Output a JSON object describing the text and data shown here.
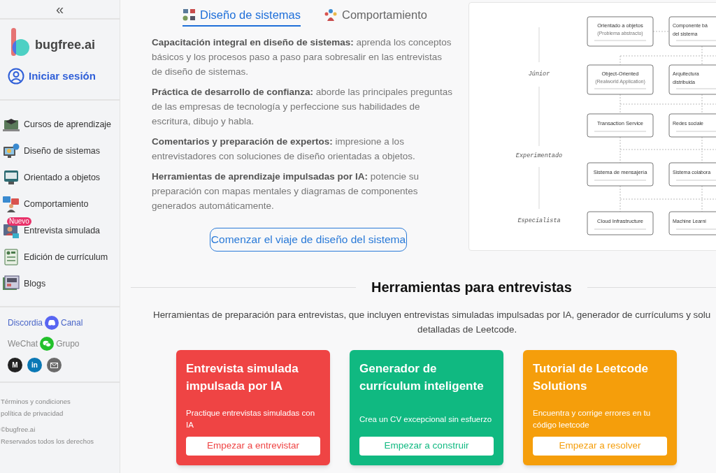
{
  "sidebar": {
    "collapse": "«",
    "brand": "bugfree.ai",
    "login": "Iniciar sesión",
    "items": [
      {
        "label": "Cursos de aprendizaje",
        "kind": "course"
      },
      {
        "label": "Diseño de sistemas",
        "kind": "system"
      },
      {
        "label": "Orientado a objetos",
        "kind": "oop"
      },
      {
        "label": "Comportamiento",
        "kind": "behavior"
      },
      {
        "label": "Entrevista simulada",
        "kind": "mock",
        "badge": "Nuevo"
      },
      {
        "label": "Edición de currículum",
        "kind": "resume"
      },
      {
        "label": "Blogs",
        "kind": "blog"
      }
    ],
    "communities": [
      {
        "label": "Discordia",
        "kind": "discord",
        "group": "Canal"
      },
      {
        "label": "WeChat",
        "kind": "wechat",
        "group": "Grupo"
      }
    ],
    "socials": [
      {
        "kind": "medium",
        "label": "M"
      },
      {
        "kind": "linkedin",
        "label": "in"
      },
      {
        "kind": "mail"
      }
    ],
    "footer": [
      "Términos y condiciones",
      "política de privacidad",
      "©bugfree.ai",
      "Reservados todos los derechos"
    ]
  },
  "tabs": [
    {
      "label": "Diseño de sistemas",
      "kind": "system",
      "selected": true
    },
    {
      "label": "Comportamiento",
      "kind": "behavior",
      "selected": false
    }
  ],
  "features": [
    "**Capacitación integral en diseño de sistemas:** aprenda los conceptos básicos y los procesos paso a paso para sobresalir en las entrevistas de diseño de sistemas.",
    "**Práctica de desarrollo de confianza:** aborde las principales preguntas de las empresas de tecnología y perfeccione sus habilidades de escritura, dibujo y habla.",
    "**Comentarios y preparación de expertos:** impresione a los entrevistadores con soluciones de diseño orientadas a objetos.",
    "**Herramientas de aprendizaje impulsadas por IA:** potencie su preparación con mapas mentales y diagramas de componentes generados automáticamente."
  ],
  "cta": "Comenzar el viaje de diseño del sistema",
  "roadmap": {
    "levels": [
      "Júnior",
      "Experimentado",
      "Especialista"
    ],
    "rows": [
      [
        {
          "lines": [
            "Orientado a objetos"
          ],
          "note": "(Problema abstracto)"
        },
        {
          "lines": [
            "Componente bá",
            "del sistema"
          ]
        }
      ],
      [
        {
          "lines": [
            "Object-Oriented"
          ],
          "note": "(Realworld Application)"
        },
        {
          "lines": [
            "Arquitectura",
            "distribuida"
          ]
        }
      ],
      [
        {
          "lines": [
            "Transaction Service"
          ]
        },
        {
          "lines": [
            "Redes sociale"
          ]
        }
      ],
      [
        {
          "lines": [
            "Sistema de mensajería"
          ]
        },
        {
          "lines": [
            "Sistema colabora"
          ]
        }
      ],
      [
        {
          "lines": [
            "Cloud Infrastructure"
          ]
        },
        {
          "lines": [
            "Machine Learni"
          ]
        }
      ]
    ]
  },
  "tools": {
    "title": "Herramientas para entrevistas",
    "description": [
      "Herramientas de preparación para entrevistas, que incluyen entrevistas simuladas impulsadas por IA, generador de currículums y solu",
      "detalladas de Leetcode."
    ],
    "cards": [
      {
        "title": "Entrevista simulada impulsada por IA",
        "text": "Practique entrevistas simuladas con IA",
        "button": "Empezar a entrevistar",
        "color": "#ef4444"
      },
      {
        "title": "Generador de currículum inteligente",
        "text": "Crea un CV excepcional sin esfuerzo",
        "button": "Empezar a construir",
        "color": "#10b981"
      },
      {
        "title": "Tutorial de Leetcode Solutions",
        "text": "Encuentra y corrige errores en tu código leetcode",
        "button": "Empezar a resolver",
        "color": "#f59e0b"
      }
    ]
  }
}
